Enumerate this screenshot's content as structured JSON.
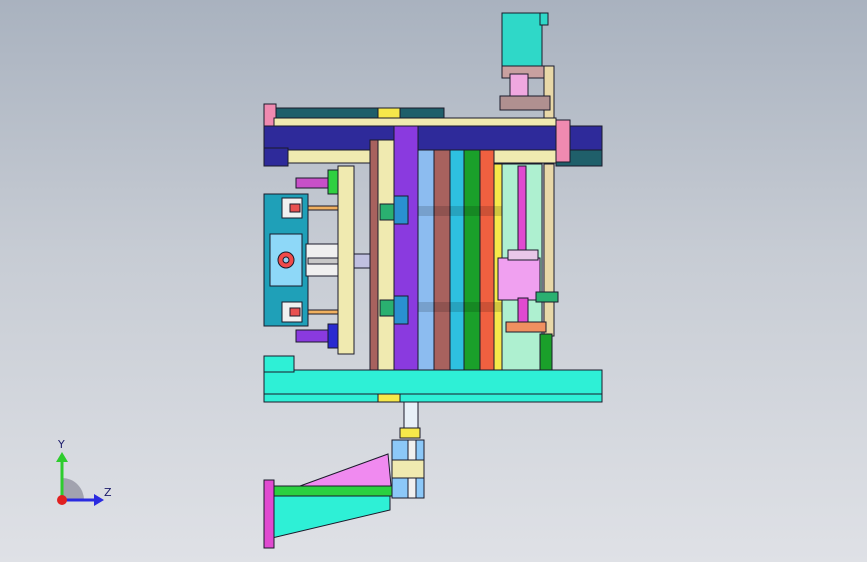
{
  "viewport": {
    "background_top": "#a9b2bf",
    "background_bottom": "#dfe1e6"
  },
  "model": {
    "description_colors": {
      "navy_plate": "#2e2a9a",
      "teal_plate": "#1f5f6a",
      "cyan_base": "#2ef0d6",
      "magenta": "#e04ad0",
      "purple": "#8a3adf",
      "brown_plate": "#a8625e",
      "cream": "#f0eab0",
      "light_blue": "#8cbcf0",
      "green_plate": "#1aa02a",
      "orange_red": "#f06040",
      "pink": "#f08ab0",
      "yellow": "#f6e84a"
    }
  },
  "triad": {
    "y_label": "Y",
    "z_label": "Z",
    "y_color": "#2ecc2e",
    "z_color": "#2a2ae0",
    "origin_color": "#e02020"
  }
}
